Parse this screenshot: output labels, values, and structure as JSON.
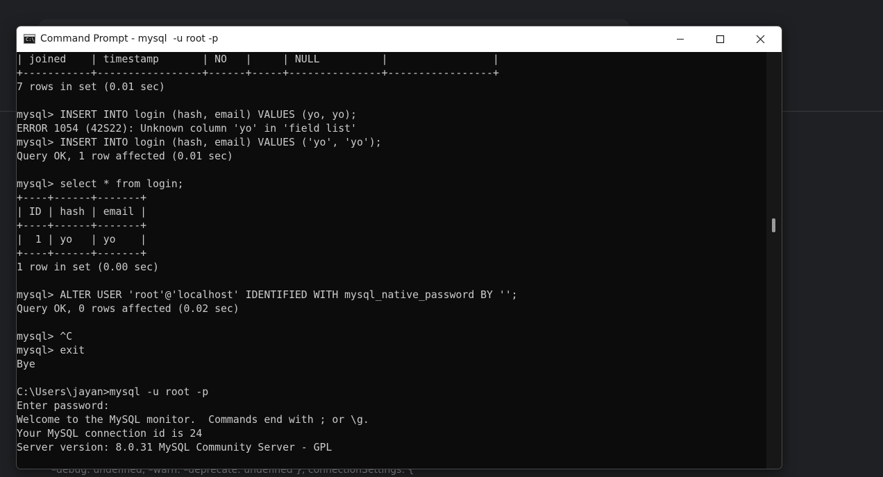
{
  "window": {
    "title": "Command Prompt - mysql  -u root -p",
    "icon_label": "C:\\_"
  },
  "background_text": "–debug: undefined, –warn: –deprecate: undefined }, connectionSettings: {",
  "icons": {
    "app": "command-prompt-icon",
    "minimize": "minimize-icon",
    "maximize": "maximize-icon",
    "close": "close-icon"
  },
  "colors": {
    "console_bg": "#0c0c0c",
    "console_text": "#cccccc",
    "titlebar_bg": "#ffffff"
  },
  "console": {
    "lines": [
      "| joined    | timestamp       | NO   |     | NULL          |                 |",
      "+-----------+-----------------+------+-----+---------------+-----------------+",
      "7 rows in set (0.01 sec)",
      "",
      "mysql> INSERT INTO login (hash, email) VALUES (yo, yo);",
      "ERROR 1054 (42S22): Unknown column 'yo' in 'field list'",
      "mysql> INSERT INTO login (hash, email) VALUES ('yo', 'yo');",
      "Query OK, 1 row affected (0.01 sec)",
      "",
      "mysql> select * from login;",
      "+----+------+-------+",
      "| ID | hash | email |",
      "+----+------+-------+",
      "|  1 | yo   | yo    |",
      "+----+------+-------+",
      "1 row in set (0.00 sec)",
      "",
      "mysql> ALTER USER 'root'@'localhost' IDENTIFIED WITH mysql_native_password BY '';",
      "Query OK, 0 rows affected (0.02 sec)",
      "",
      "mysql> ^C",
      "mysql> exit",
      "Bye",
      "",
      "C:\\Users\\jayan>mysql -u root -p",
      "Enter password:",
      "Welcome to the MySQL monitor.  Commands end with ; or \\g.",
      "Your MySQL connection id is 24",
      "Server version: 8.0.31 MySQL Community Server - GPL"
    ]
  }
}
